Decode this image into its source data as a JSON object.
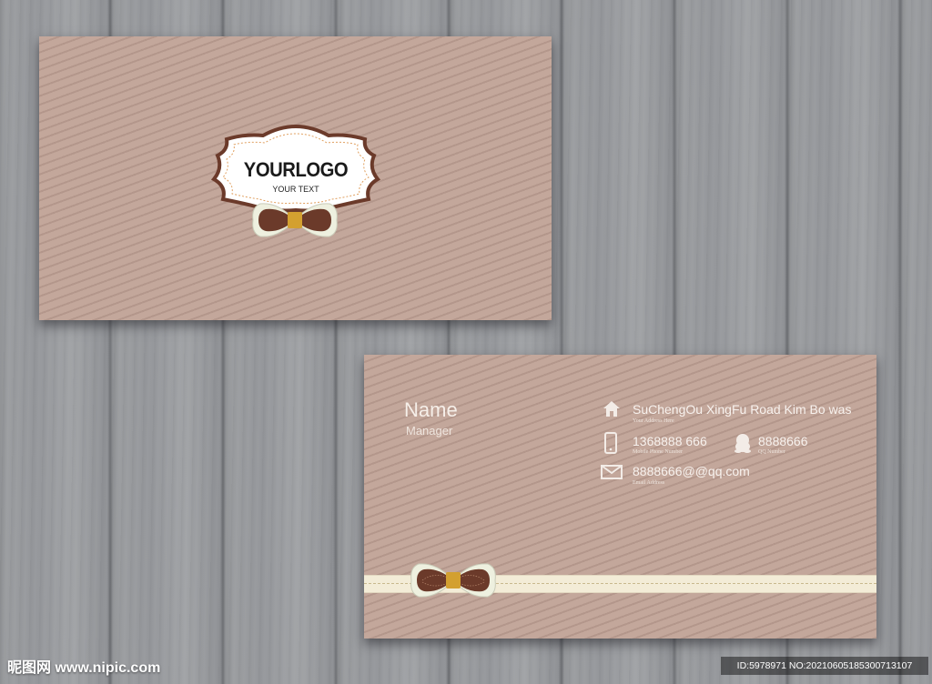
{
  "front": {
    "logo": "YOURLOGO",
    "tagline": "YOUR TEXT"
  },
  "back": {
    "name": "Name",
    "title": "Manager",
    "address": {
      "value": "SuChengOu XingFu Road Kim Bo was",
      "label": "Your Address Here",
      "icon": "home-icon"
    },
    "phone": {
      "value": "1368888 666",
      "label": "Mobile Phone Number",
      "icon": "mobile-phone-icon"
    },
    "qq": {
      "value": "8888666",
      "label": "QQ Number",
      "icon": "qq-penguin-icon"
    },
    "email": {
      "value": "8888666@@qq.com",
      "label": "Email Address",
      "icon": "envelope-icon"
    }
  },
  "watermark": {
    "site": "昵图网 www.nipic.com",
    "id": "ID:5978971 NO:20210605185300713107"
  },
  "colors": {
    "card": "#c3a79b",
    "wood": "#94969a",
    "bow": "#6b3a2a",
    "knot": "#d3a030"
  }
}
